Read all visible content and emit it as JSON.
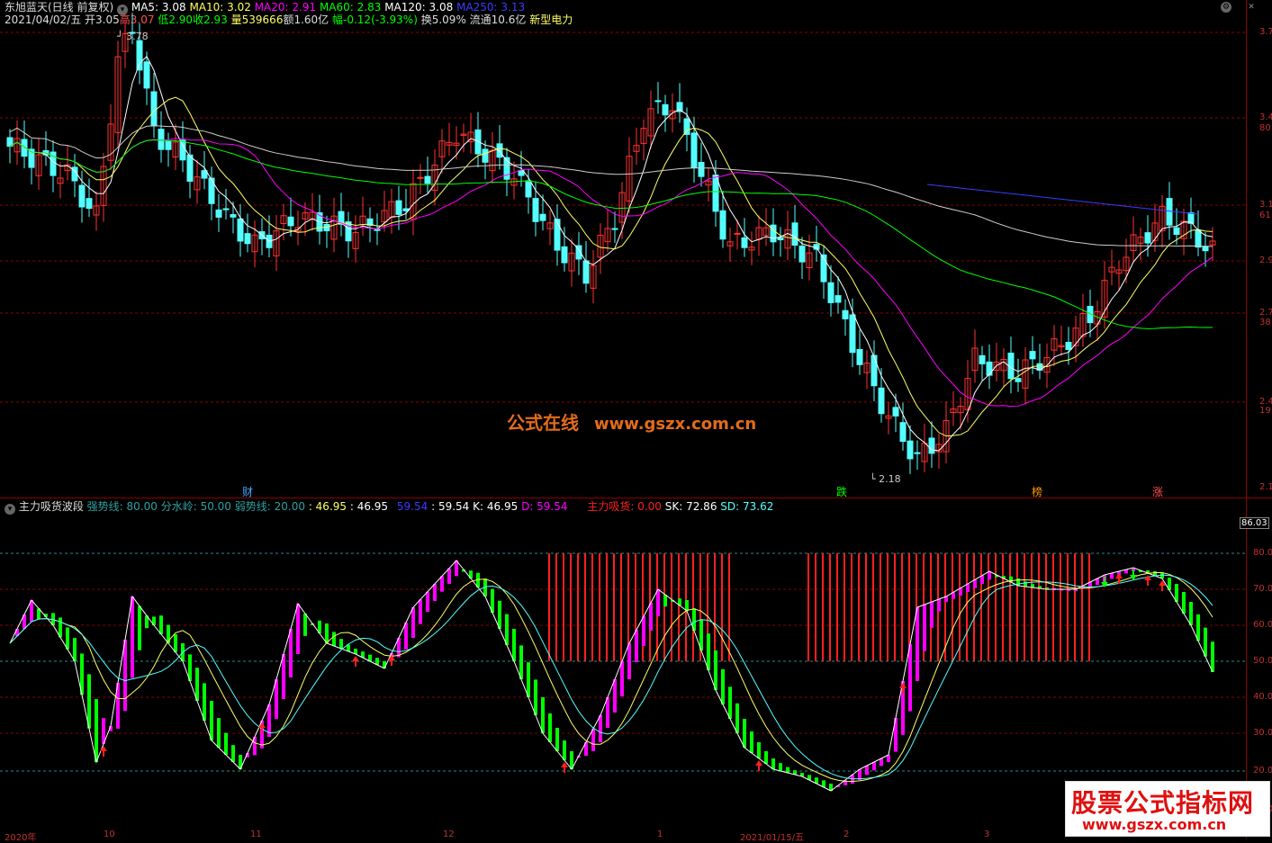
{
  "main_header": {
    "stock": "东旭蓝天(日线 前复权)",
    "ma5": "MA5: 3.08",
    "ma10": "MA10: 3.02",
    "ma20": "MA20: 2.91",
    "ma60": "MA60: 2.83",
    "ma120": "MA120: 3.08",
    "ma250": "MA250: 3.13",
    "date": "2021/04/02/五",
    "open": "开3.05",
    "high": "高3.07",
    "low": "低2.90",
    "close": "收2.93",
    "volume": "量539666",
    "amount": "额1.60亿",
    "change": "幅-0.12(-3.93%)",
    "turnover": "换5.09%",
    "float": "流通10.6亿",
    "concept": "新型电力"
  },
  "price_annotations": {
    "high_label": "3.78",
    "low_label": "2.18"
  },
  "right_axis_top": [
    "3.7",
    "3.4",
    "80.9",
    "3.1",
    "61.8",
    "2.9",
    "2.7",
    "38.2",
    "2.4",
    "19.1",
    "2.1"
  ],
  "markers": {
    "cai": "财",
    "die": "跌",
    "bang": "榜",
    "zhang": "涨"
  },
  "watermark": {
    "cn": "公式在线",
    "url": "www.gszx.com.cn"
  },
  "indicator_header": {
    "name": "主力吸货波段",
    "strong": "强势线: 80.00",
    "water": "分水岭: 50.00",
    "weak": "弱势线: 20.00",
    "v1": ": 46.95",
    "v2": ": 46.95",
    "v3": "59.54",
    "v4": ": 59.54",
    "k": "K: 46.95",
    "d": "D: 59.54",
    "main_buy": "主力吸货: 0.00",
    "sk": "SK: 72.86",
    "sd": "SD: 73.62"
  },
  "right_axis_bottom": [
    "86.03",
    "80.0",
    "70.0",
    "60.0",
    "50.0",
    "40.0",
    "30.0",
    "20.0",
    "10.0"
  ],
  "bottom_dates": [
    "2020年",
    "10",
    "11",
    "12",
    "1",
    "2021/01/15/五",
    "2",
    "3"
  ],
  "logo": {
    "title": "股票公式指标网",
    "url": "www.gszx.com.cn"
  },
  "colors": {
    "up": "#ff3232",
    "down": "#54ffff",
    "ma5": "#ffffff",
    "ma10": "#ffff64",
    "ma20": "#ff00ff",
    "ma60": "#00ff00",
    "ma250": "#3c3cff",
    "osc_up": "#ff00ff",
    "osc_down": "#00ff00",
    "buy_zone": "#ff2020"
  }
}
